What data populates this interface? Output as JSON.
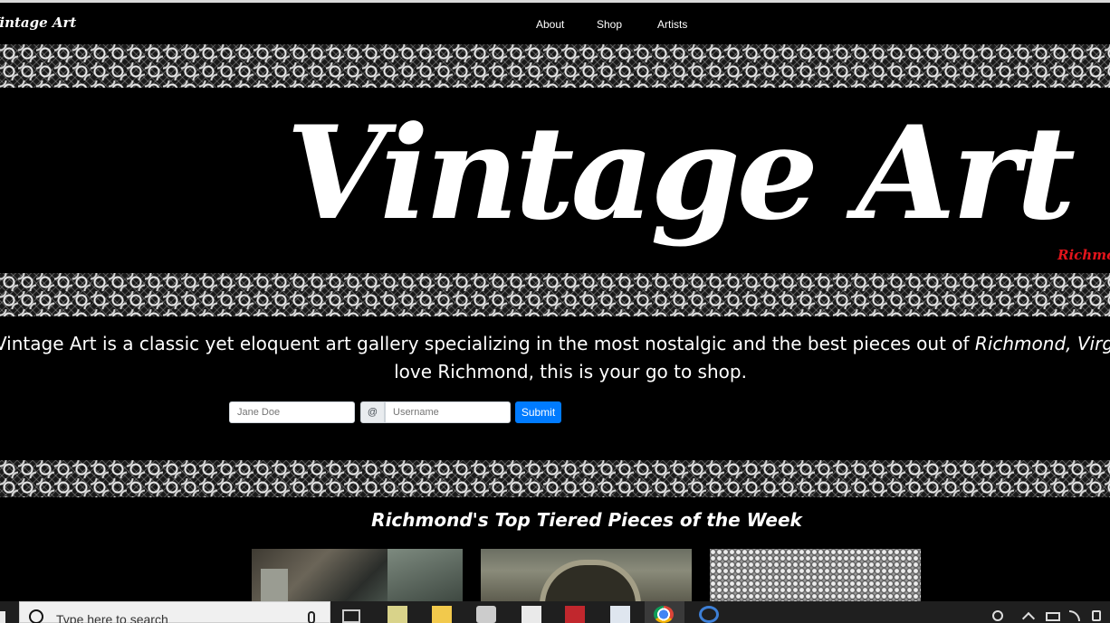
{
  "navbar": {
    "brand": "Vintage Art",
    "links": [
      "About",
      "Shop",
      "Artists"
    ]
  },
  "hero": {
    "title": "Vintage  Art",
    "subtitle": "Richmond"
  },
  "description": {
    "line1_before": "Vintage Art is a classic yet eloquent art gallery specializing in the most nostalgic and the best pieces out of ",
    "line1_em": "Richmond, Virginia",
    "line2": "love Richmond, this is your go to shop."
  },
  "form": {
    "name_placeholder": "Jane Doe",
    "at_addon": "@",
    "username_placeholder": "Username",
    "submit_label": "Submit"
  },
  "section": {
    "title": "Richmond's Top Tiered Pieces of the Week"
  },
  "taskbar": {
    "search_placeholder": "Type here to search",
    "icons": [
      "task-view-icon",
      "notepad-icon",
      "file-explorer-icon",
      "store-icon",
      "mail-icon",
      "filezilla-icon",
      "document-icon",
      "chrome-icon",
      "app-icon"
    ],
    "tray_icons": [
      "people-icon",
      "chevron-up-icon",
      "battery-icon",
      "wifi-icon",
      "volume-icon"
    ]
  },
  "colors": {
    "accent": "#e3141b",
    "button": "#007bff",
    "background": "#000000"
  }
}
